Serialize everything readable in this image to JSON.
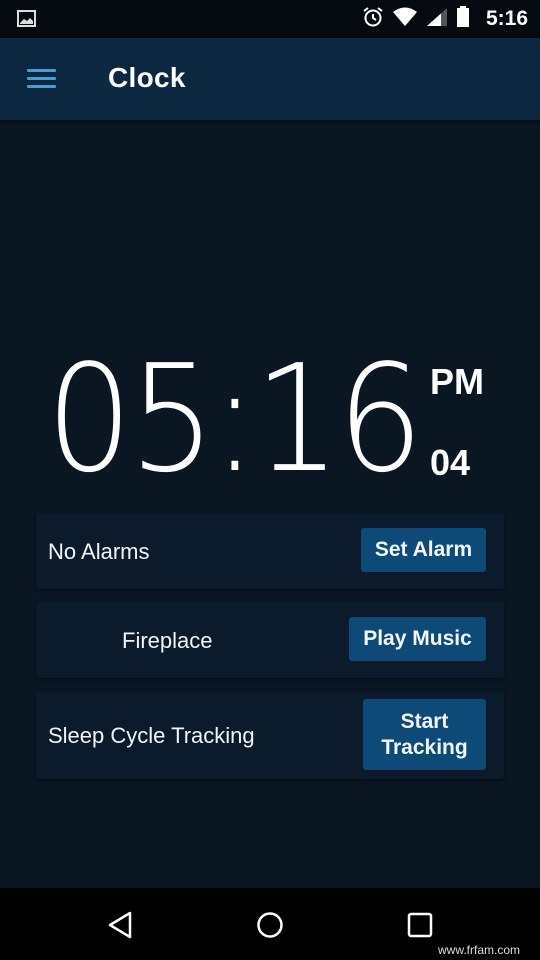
{
  "status_bar": {
    "time": "5:16",
    "icons": [
      "gallery-icon",
      "alarm-icon",
      "wifi-icon",
      "signal-icon",
      "battery-icon"
    ]
  },
  "app_bar": {
    "menu_icon": "menu-icon",
    "title": "Clock"
  },
  "clock": {
    "hours_minutes": "05:16",
    "period": "PM",
    "seconds": "04"
  },
  "cards": [
    {
      "label": "No Alarms",
      "button": "Set Alarm"
    },
    {
      "label": "Fireplace",
      "button": "Play Music"
    },
    {
      "label": "Sleep Cycle Tracking",
      "button_line1": "Start",
      "button_line2": "Tracking"
    }
  ],
  "nav_bar": {
    "back": "back-icon",
    "home": "home-icon",
    "recents": "recents-icon"
  },
  "watermark": "www.frfam.com",
  "colors": {
    "background": "#0a1622",
    "app_bar": "#0b2840",
    "card": "#0b1b2b",
    "button": "#0e4a78",
    "menu_accent": "#4f9bd0"
  }
}
